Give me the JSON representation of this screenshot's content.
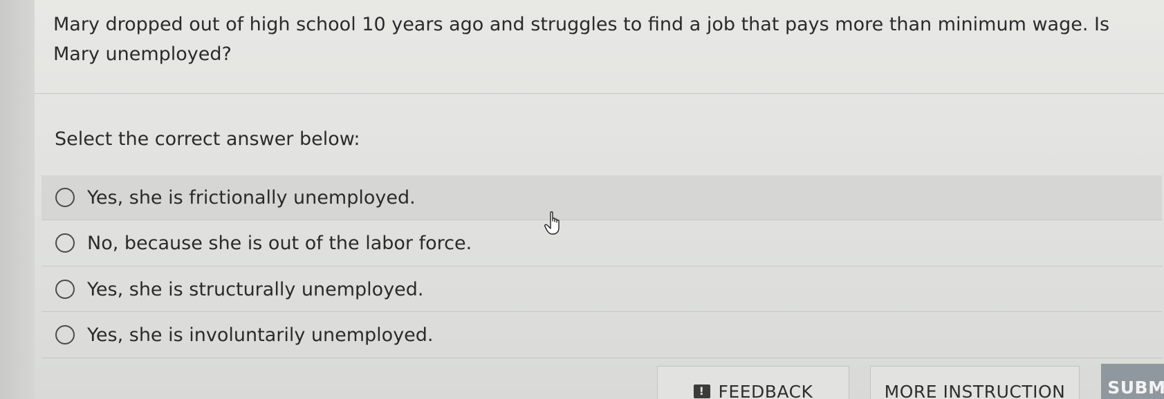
{
  "question": {
    "text": "Mary dropped out of high school 10 years ago and struggles to find a job that pays more than minimum wage. Is Mary unemployed?"
  },
  "prompt": "Select the correct answer below:",
  "options": [
    {
      "label": "Yes, she is frictionally unemployed.",
      "selected": false
    },
    {
      "label": "No, because she is out of the labor force.",
      "selected": false
    },
    {
      "label": "Yes, she is structurally unemployed.",
      "selected": false
    },
    {
      "label": "Yes, she is involuntarily unemployed.",
      "selected": false
    }
  ],
  "buttons": {
    "feedback_icon": "!",
    "feedback_label": "FEEDBACK",
    "more_instruction_label": "MORE INSTRUCTION",
    "submit_label": "SUBMIT"
  },
  "colors": {
    "background": "#e1e2df",
    "text": "#2a2a2a",
    "submit_bg": "#8f979f",
    "hover_row": "#d6d7d4"
  },
  "icons": {
    "cursor": "pointer-hand-cursor-icon",
    "radio": "radio-button-empty-icon",
    "feedback": "alert-square-icon"
  }
}
